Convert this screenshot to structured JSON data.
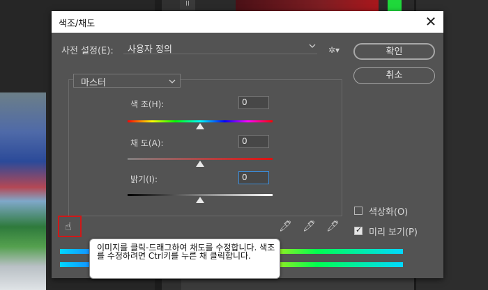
{
  "dialog": {
    "title": "색조/채도",
    "close_label": "✕",
    "preset_label": "사전 설정(E):",
    "preset_value": "사용자 정의",
    "ok_label": "확인",
    "cancel_label": "취소",
    "channel_value": "마스터",
    "hue": {
      "label": "색 조(H):",
      "value": "0",
      "slider_fraction": 0.5
    },
    "saturation": {
      "label": "채 도(A):",
      "value": "0",
      "slider_fraction": 0.5
    },
    "lightness": {
      "label": "밝기(I):",
      "value": "0",
      "slider_fraction": 0.5
    },
    "colorize_label": "색상화(O)",
    "colorize_checked": false,
    "preview_label": "미리 보기(P)",
    "preview_checked": true,
    "tooltip": "이미지를 클릭-드래그하여 채도를 수정합니다. 색조를 수정하려면 Ctrl키를 누른 채 클릭합니다."
  },
  "background": {
    "small_tab": "II"
  },
  "icons": [
    "close-icon",
    "chevron-down-icon",
    "gear-icon",
    "hand-adjust-icon",
    "eyedropper-icon",
    "eyedropper-plus-icon",
    "eyedropper-minus-icon",
    "checkmark-icon"
  ],
  "colors": {
    "dialog_bg": "#535353",
    "highlight_red": "#d01818",
    "focus_blue": "#3d8bd6"
  }
}
